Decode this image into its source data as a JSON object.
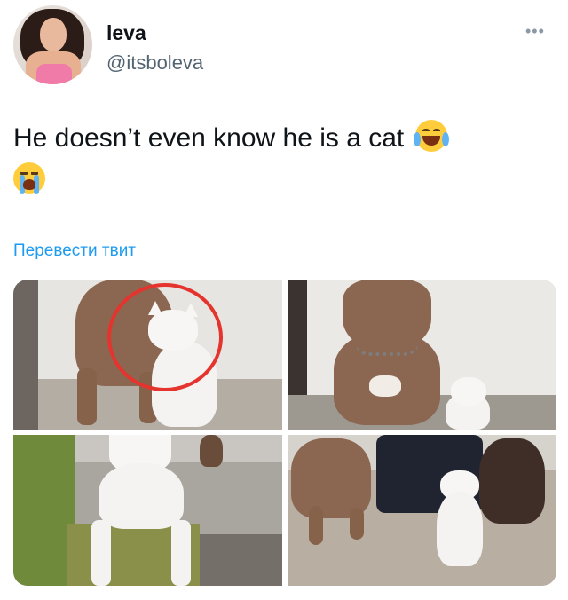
{
  "tweet": {
    "display_name": "leva",
    "handle": "@itsboleva",
    "more_icon": "more-horizontal-icon",
    "text": "He doesn’t even know he is a cat",
    "emojis": [
      "face-with-tears-of-joy-icon",
      "loudly-crying-face-icon"
    ],
    "translate_label": "Перевести твит"
  },
  "media": {
    "photo_count": 4,
    "photos": [
      {
        "id": "photo-1",
        "description_icon": "red-circle-annotation"
      },
      {
        "id": "photo-2"
      },
      {
        "id": "photo-3"
      },
      {
        "id": "photo-4"
      }
    ]
  },
  "colors": {
    "text": "#0f1419",
    "secondary_text": "#536471",
    "link": "#1d9bf0",
    "annotation_red": "#e5332e"
  }
}
